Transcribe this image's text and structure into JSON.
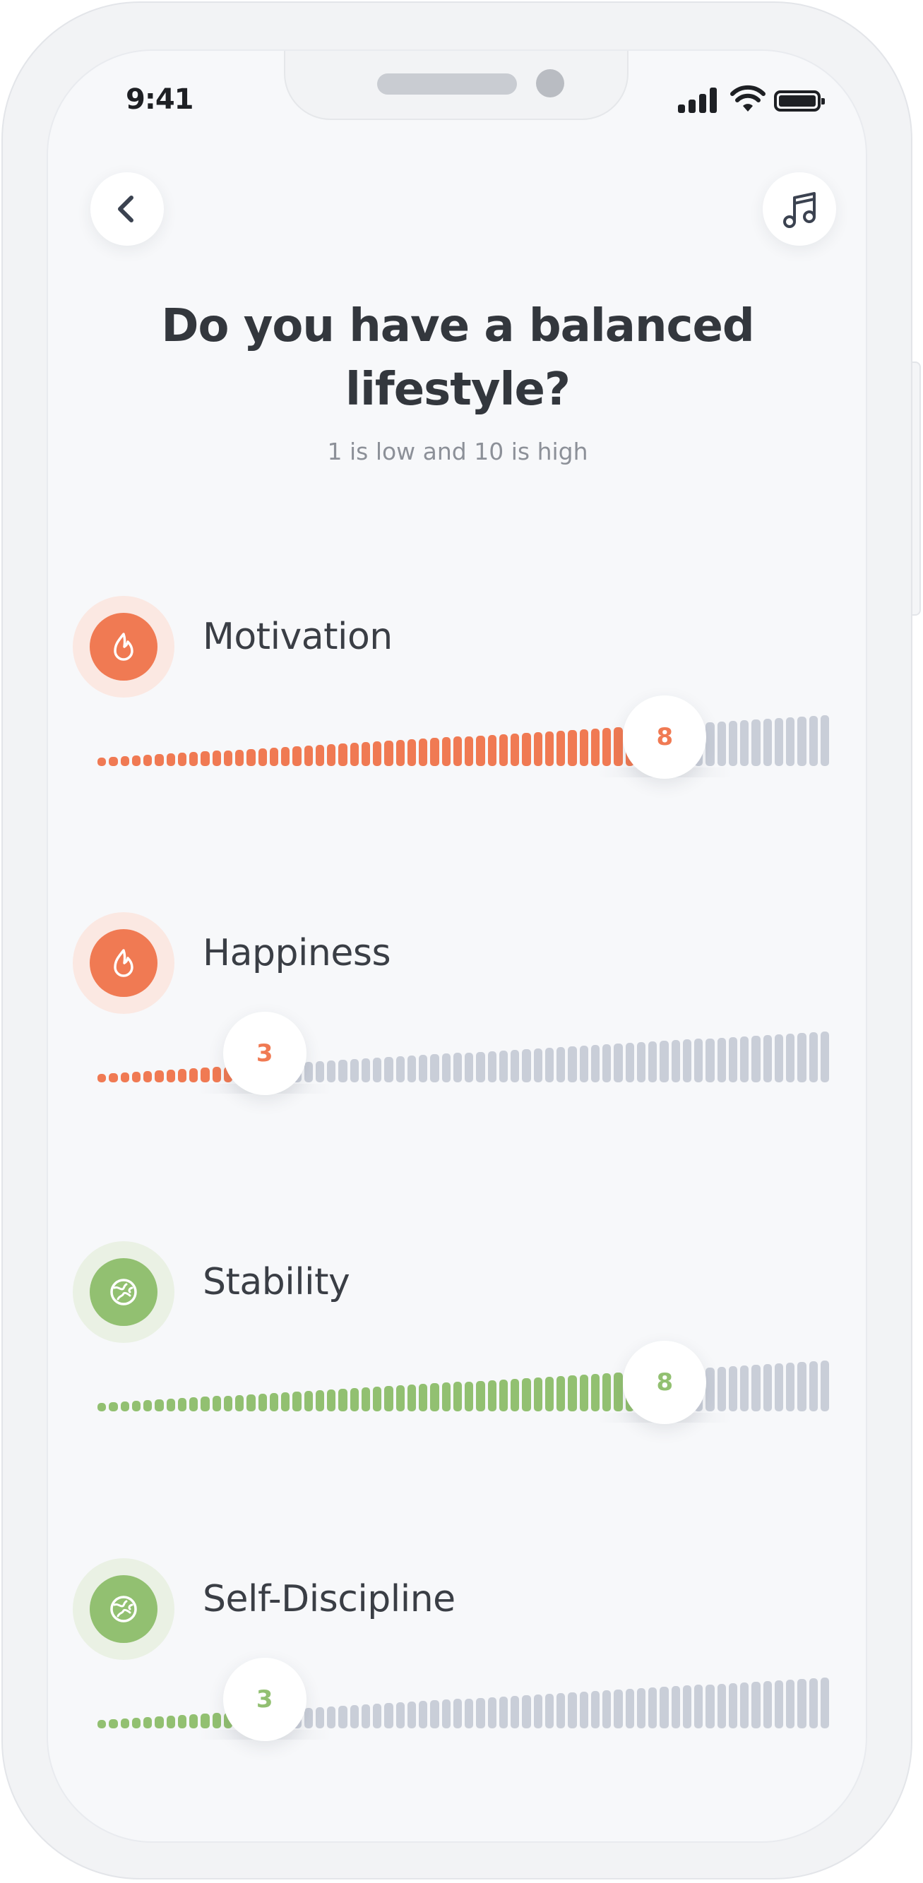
{
  "status_bar": {
    "time": "9:41"
  },
  "header": {
    "back_icon": "chevron-left-icon",
    "music_icon": "music-note-icon"
  },
  "title": "Do you have a balanced lifestyle?",
  "subtitle": "1 is low and 10 is high",
  "colors": {
    "orange": "#f07a53",
    "orange_light": "#fbe8e2",
    "green": "#92c071",
    "green_light": "#eaf1e4",
    "track_gray": "#c9ced8",
    "text_dark": "#3a3e45"
  },
  "scale": {
    "min": 1,
    "max": 10
  },
  "metrics": [
    {
      "label": "Motivation",
      "value": "8",
      "icon": "flame-icon",
      "color": "orange"
    },
    {
      "label": "Happiness",
      "value": "3",
      "icon": "flame-icon",
      "color": "orange"
    },
    {
      "label": "Stability",
      "value": "8",
      "icon": "globe-icon",
      "color": "green"
    },
    {
      "label": "Self-Discipline",
      "value": "3",
      "icon": "globe-icon",
      "color": "green"
    }
  ]
}
